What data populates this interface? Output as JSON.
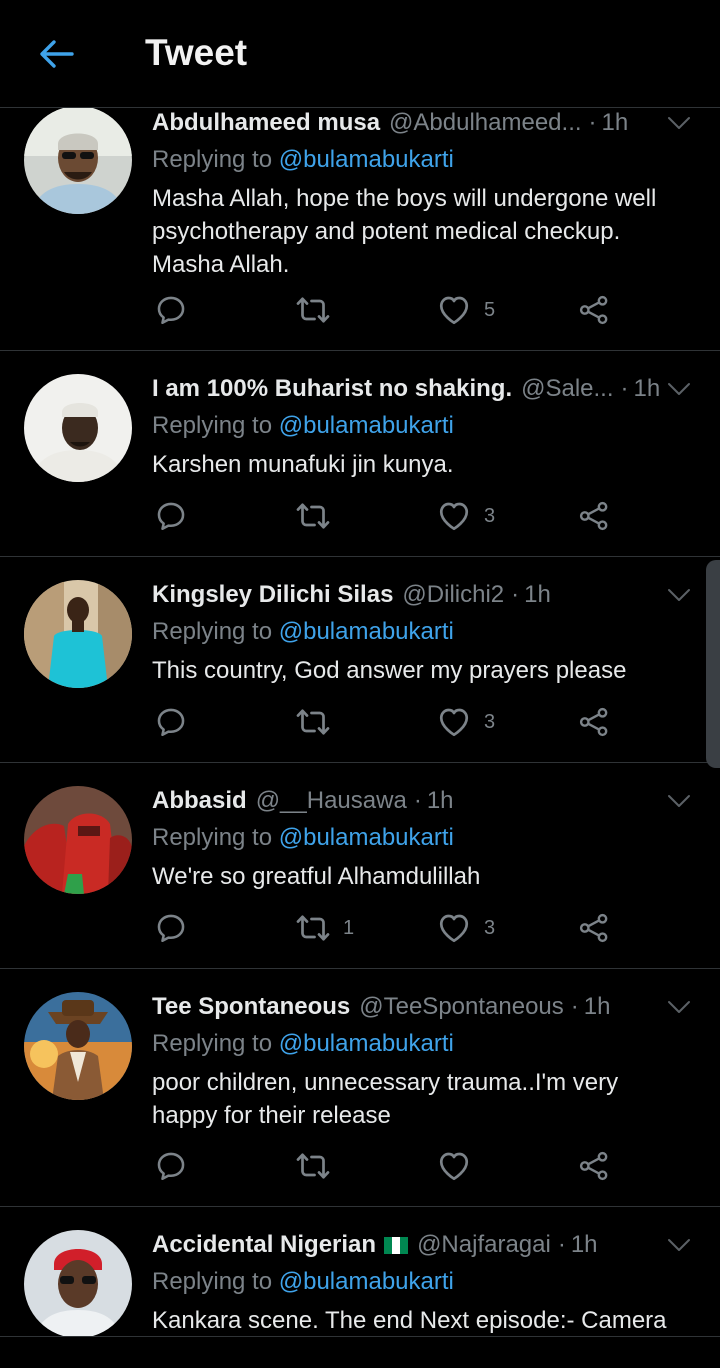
{
  "header": {
    "title": "Tweet"
  },
  "tweets": [
    {
      "display_name": "Abdulhameed musa",
      "handle": "@Abdulhameed...",
      "time": "1h",
      "replying_prefix": "Replying to",
      "replying_to": "@bulamabukarti",
      "text": "Masha Allah, hope the boys will undergone well psychotherapy and potent medical checkup. Masha Allah.",
      "retweets": "",
      "likes": "5"
    },
    {
      "display_name": "I am 100% Buharist no shaking.",
      "handle": "@Sale...",
      "time": "1h",
      "replying_prefix": "Replying to",
      "replying_to": "@bulamabukarti",
      "text": "Karshen munafuki jin kunya.",
      "retweets": "",
      "likes": "3"
    },
    {
      "display_name": "Kingsley Dilichi Silas",
      "handle": "@Dilichi2",
      "time": "1h",
      "replying_prefix": "Replying to",
      "replying_to": "@bulamabukarti",
      "text": "This country, God answer my prayers please",
      "retweets": "",
      "likes": "3"
    },
    {
      "display_name": "Abbasid",
      "handle": "@__Hausawa",
      "time": "1h",
      "replying_prefix": "Replying to",
      "replying_to": "@bulamabukarti",
      "text": "We're so greatful Alhamdulillah",
      "retweets": "1",
      "likes": "3"
    },
    {
      "display_name": "Tee Spontaneous",
      "handle": "@TeeSpontaneous",
      "time": "1h",
      "replying_prefix": "Replying to",
      "replying_to": "@bulamabukarti",
      "text": "poor children, unnecessary trauma..I'm very happy for their release",
      "retweets": "",
      "likes": ""
    },
    {
      "display_name": "Accidental Nigerian",
      "handle": "@Najfaragai",
      "time": "1h",
      "replying_prefix": "Replying to",
      "replying_to": "@bulamabukarti",
      "text": "Kankara scene. The end  Next episode:- Camera",
      "retweets": "",
      "likes": ""
    }
  ],
  "colors": {
    "accent": "#3fa3ea",
    "muted": "#7c8389",
    "background": "#000000",
    "divider": "#2f3336"
  }
}
